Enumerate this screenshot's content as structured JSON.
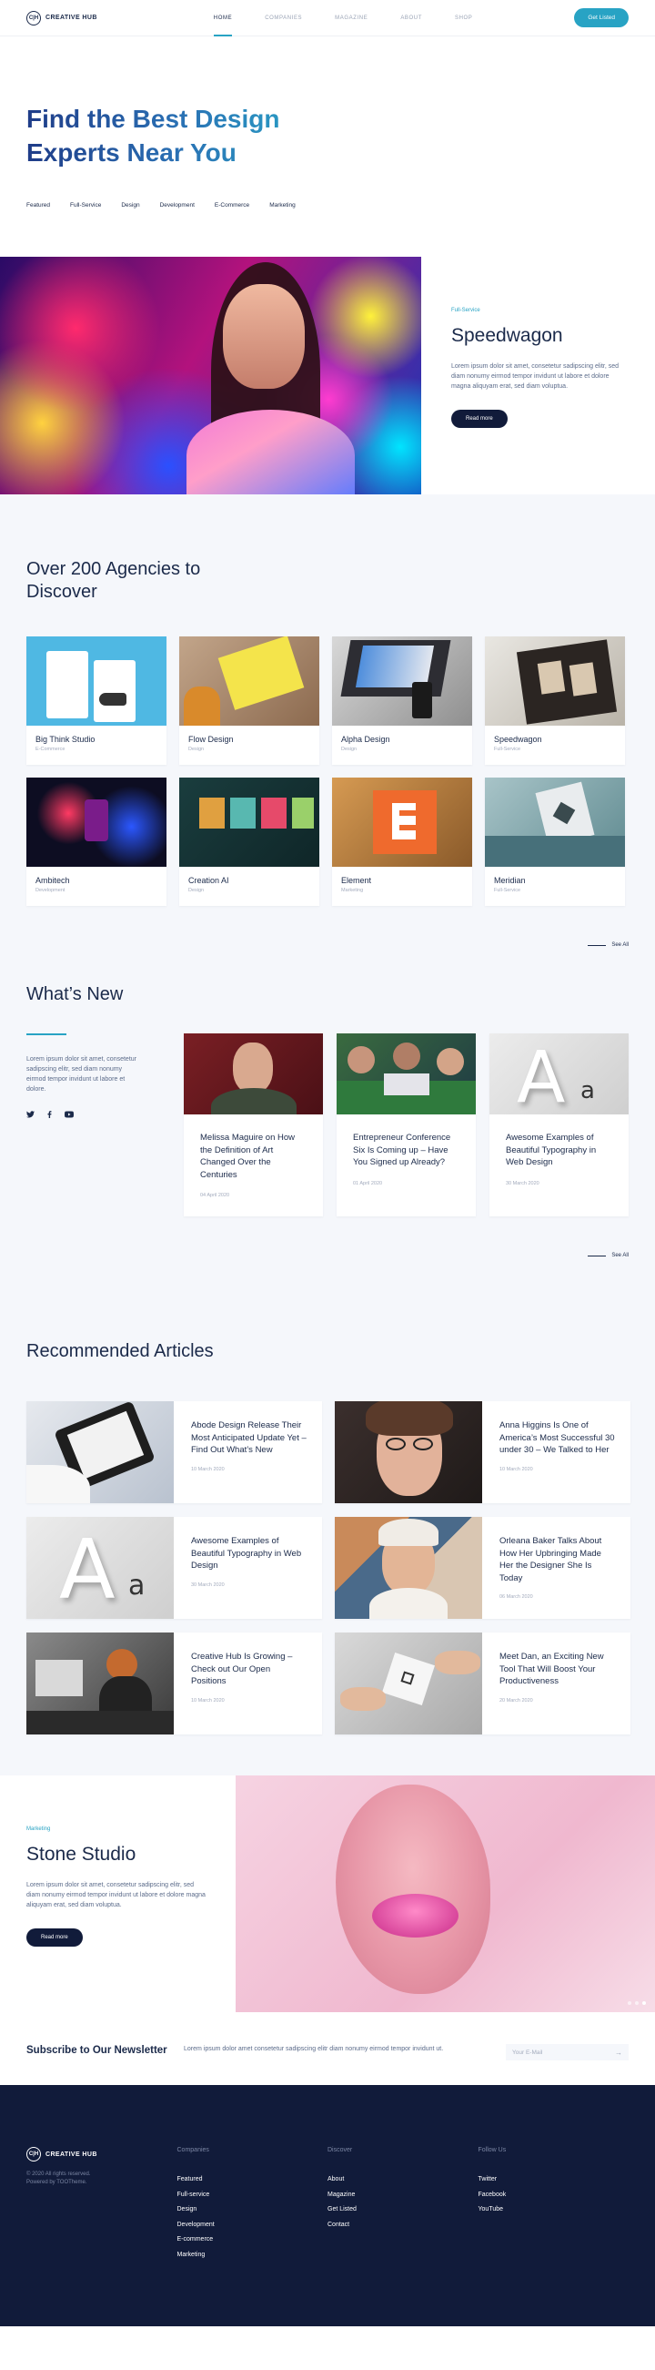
{
  "header": {
    "logo_mark": "C|H",
    "logo_text": "CREATIVE HUB",
    "nav": [
      "HOME",
      "COMPANIES",
      "MAGAZINE",
      "ABOUT",
      "SHOP"
    ],
    "cta": "Get Listed",
    "accent": "#28a3c4"
  },
  "hero": {
    "title": "Find the Best Design Experts Near You",
    "categories": [
      "Featured",
      "Full-Service",
      "Design",
      "Development",
      "E-Commerce",
      "Marketing"
    ]
  },
  "featured": {
    "eyebrow": "Full-Service",
    "title": "Speedwagon",
    "text": "Lorem ipsum dolor sit amet, consetetur sadipscing elitr, sed diam nonumy eirmod tempor invidunt ut labore et dolore magna aliquyam erat, sed diam voluptua.",
    "button": "Read more"
  },
  "agencies": {
    "title": "Over 200 Agencies to Discover",
    "items": [
      {
        "name": "Big Think Studio",
        "category": "E-Commerce"
      },
      {
        "name": "Flow Design",
        "category": "Design"
      },
      {
        "name": "Alpha Design",
        "category": "Design"
      },
      {
        "name": "Speedwagon",
        "category": "Full-Service"
      },
      {
        "name": "Ambitech",
        "category": "Development"
      },
      {
        "name": "Creation AI",
        "category": "Design"
      },
      {
        "name": "Element",
        "category": "Marketing"
      },
      {
        "name": "Meridian",
        "category": "Full-Service"
      }
    ],
    "see_all": "See All"
  },
  "whats_new": {
    "title": "What’s New",
    "text": "Lorem ipsum dolor sit amet, consetetur sadipscing elitr, sed diam nonumy eirmod tempor invidunt ut labore et dolore.",
    "social": [
      "twitter-icon",
      "facebook-icon",
      "youtube-icon"
    ],
    "items": [
      {
        "title": "Melissa Maguire on How the Definition of Art Changed Over the Centuries",
        "date": "04 April 2020"
      },
      {
        "title": "Entrepreneur Conference Six Is Coming up – Have You Signed up Already?",
        "date": "01 April 2020"
      },
      {
        "title": "Awesome Examples of Beautiful Typography in Web Design",
        "date": "30 March 2020"
      }
    ],
    "see_all": "See All"
  },
  "recommended": {
    "title": "Recommended Articles",
    "items": [
      {
        "title": "Abode Design Release Their Most Anticipated Update Yet – Find Out What’s New",
        "date": "10 March 2020"
      },
      {
        "title": "Anna Higgins Is One of America’s Most Successful 30 under 30 – We Talked to Her",
        "date": "10 March 2020"
      },
      {
        "title": "Awesome Examples of Beautiful Typography in Web Design",
        "date": "30 March 2020"
      },
      {
        "title": "Orleana Baker Talks About How Her Upbringing Made Her the Designer She Is Today",
        "date": "06 March 2020"
      },
      {
        "title": "Creative Hub Is Growing – Check out Our Open Positions",
        "date": "10 March 2020"
      },
      {
        "title": "Meet Dan, an Exciting New Tool That Will Boost Your Productiveness",
        "date": "20 March 2020"
      }
    ]
  },
  "stone": {
    "eyebrow": "Marketing",
    "title": "Stone Studio",
    "text": "Lorem ipsum dolor sit amet, consetetur sadipscing elitr, sed diam nonumy eirmod tempor invidunt ut labore et dolore magna aliquyam erat, sed diam voluptua.",
    "button": "Read more"
  },
  "subscribe": {
    "title": "Subscribe to Our Newsletter",
    "text": "Lorem ipsum dolor amet consetetur sadipscing elitr diam nonumy eirmod tempor invidunt ut.",
    "placeholder": "Your E-Mail"
  },
  "footer": {
    "logo_mark": "C|H",
    "logo_text": "CREATIVE HUB",
    "copyright": "© 2020 All rights reserved.",
    "powered": "Powered by TOOTheme.",
    "columns": [
      {
        "title": "Companies",
        "links": [
          "Featured",
          "Full-service",
          "Design",
          "Development",
          "E-commerce",
          "Marketing"
        ]
      },
      {
        "title": "Discover",
        "links": [
          "About",
          "Magazine",
          "Get Listed",
          "Contact"
        ]
      },
      {
        "title": "Follow Us",
        "links": [
          "Twitter",
          "Facebook",
          "YouTube"
        ]
      }
    ]
  }
}
